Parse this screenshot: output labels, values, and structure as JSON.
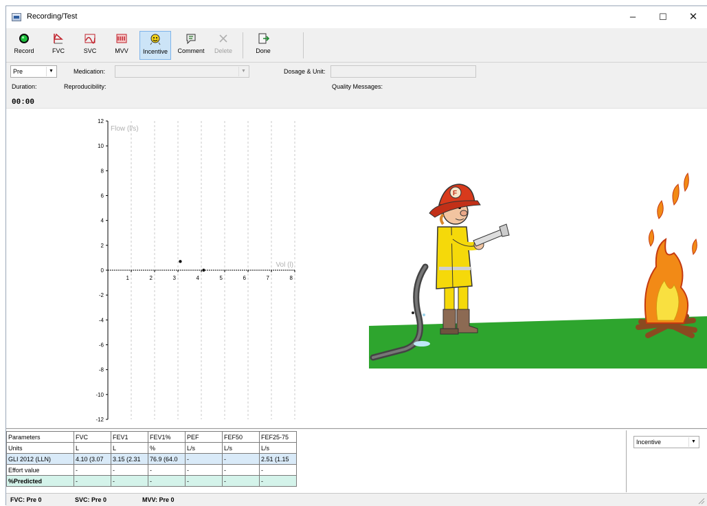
{
  "window": {
    "title": "Recording/Test",
    "controls": {
      "minimize": "–",
      "maximize": "☐",
      "close": "✕"
    }
  },
  "toolbar": {
    "buttons": [
      {
        "label": "Record",
        "icon": "record-icon",
        "state": "normal"
      },
      {
        "label": "FVC",
        "icon": "fvc-icon",
        "state": "normal"
      },
      {
        "label": "SVC",
        "icon": "svc-icon",
        "state": "normal"
      },
      {
        "label": "MVV",
        "icon": "mvv-icon",
        "state": "normal"
      },
      {
        "label": "Incentive",
        "icon": "incentive-icon",
        "state": "active"
      },
      {
        "label": "Comment",
        "icon": "comment-icon",
        "state": "normal"
      },
      {
        "label": "Delete",
        "icon": "delete-icon",
        "state": "disabled"
      },
      {
        "label": "Done",
        "icon": "done-icon",
        "state": "normal"
      }
    ]
  },
  "settings": {
    "phase_value": "Pre",
    "medication_label": "Medication:",
    "medication_value": "",
    "dosage_label": "Dosage & Unit:",
    "dosage_value": "",
    "duration_label": "Duration:",
    "duration_value": "00:00",
    "reproducibility_label": "Reproducibility:",
    "quality_label": "Quality Messages:"
  },
  "chart_data": {
    "type": "scatter",
    "ylabel": "Flow (l/s)",
    "xlabel": "Vol (l)",
    "xlim": [
      0,
      8
    ],
    "ylim": [
      -12,
      12
    ],
    "x_ticks": [
      "1",
      "2",
      "3",
      "4",
      "5",
      "6",
      "7",
      "8"
    ],
    "y_ticks": [
      "12",
      "10",
      "8",
      "6",
      "4",
      "2",
      "0",
      "-2",
      "-4",
      "-6",
      "-8",
      "-10",
      "-12"
    ],
    "grid": true,
    "series": [
      {
        "points": [
          {
            "x": 3.1,
            "y": 0.7
          },
          {
            "x": 4.1,
            "y": 0.0
          }
        ]
      }
    ],
    "colors": {
      "grid": "#c8c8c8",
      "axis": "#000000",
      "label": "#b0b0b0"
    }
  },
  "params_table": {
    "columns": [
      "Parameters",
      "FVC",
      "FEV1",
      "FEV1%",
      "PEF",
      "FEF50",
      "FEF25-75"
    ],
    "rows": [
      {
        "cells": [
          "Units",
          "L",
          "L",
          "%",
          "L/s",
          "L/s",
          "L/s"
        ],
        "style": "plain"
      },
      {
        "cells": [
          "GLI 2012 (LLN)",
          "4.10 (3.07",
          "3.15 (2.31",
          "76.9 (64.0",
          "-",
          "-",
          "2.51 (1.15"
        ],
        "style": "blue"
      },
      {
        "cells": [
          "Effort value",
          "-",
          "-",
          "-",
          "-",
          "-",
          "-"
        ],
        "style": "plain"
      },
      {
        "cells": [
          "%Predicted",
          "-",
          "-",
          "-",
          "-",
          "-",
          "-"
        ],
        "style": "mint"
      }
    ]
  },
  "display_mode": {
    "value": "Incentive"
  },
  "statusbar": {
    "fvc": "FVC:  Pre 0",
    "svc": "SVC:  Pre 0",
    "mvv": "MVV:  Pre 0"
  },
  "colors": {
    "active_tab": "#cce4f7",
    "table_blue": "#d9eaf8",
    "table_mint": "#d4f3ea",
    "grass": "#2ea52e",
    "record_green": "#1bbf3b"
  }
}
